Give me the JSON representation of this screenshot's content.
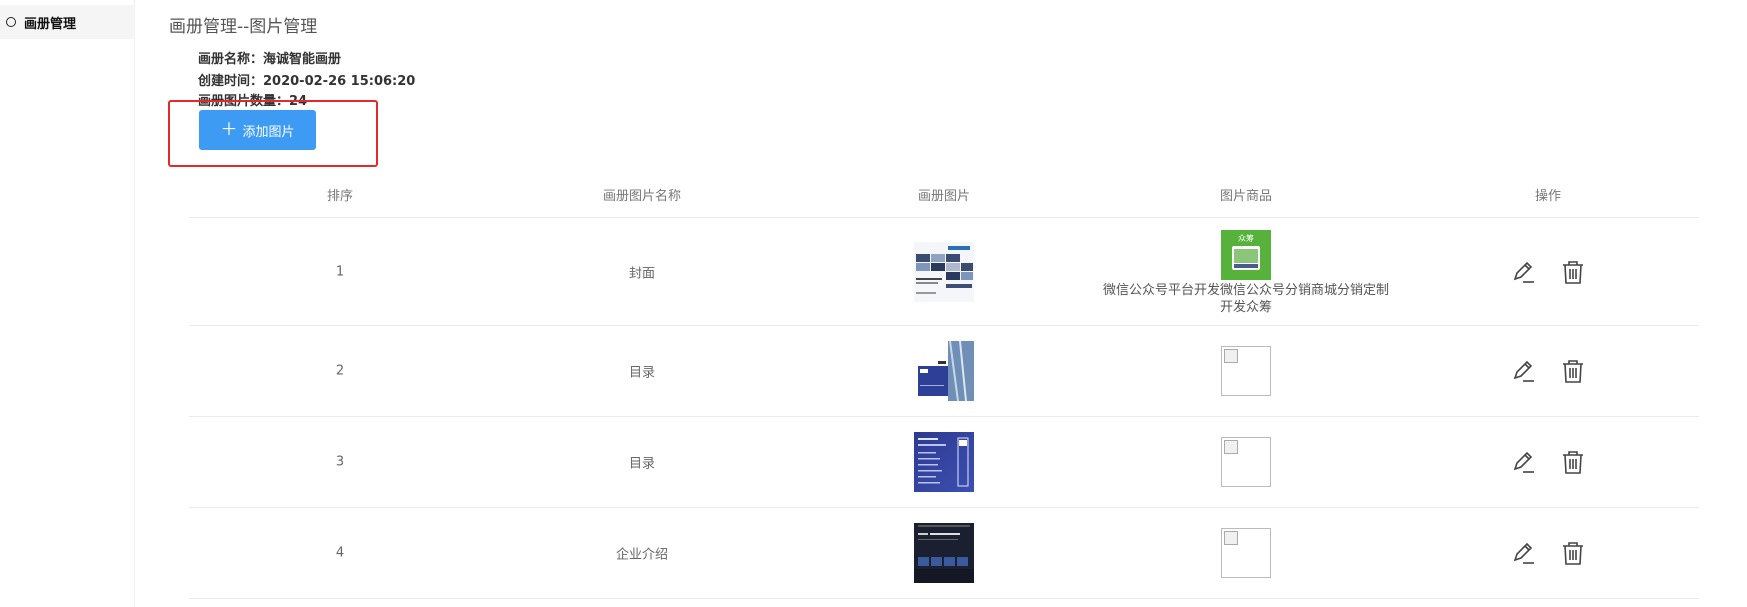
{
  "sidebar": {
    "items": [
      {
        "label": "画册管理"
      }
    ]
  },
  "header": {
    "title": "画册管理--图片管理"
  },
  "album": {
    "name_line": "画册名称：海诚智能画册",
    "created_line": "创建时间：2020-02-26 15:06:20",
    "count_line": "画册图片数量：24"
  },
  "toolbar": {
    "add_label": "添加图片"
  },
  "table": {
    "headers": [
      "排序",
      "画册图片名称",
      "画册图片",
      "图片商品",
      "操作"
    ],
    "rows": [
      {
        "order": "1",
        "name": "封面",
        "thumb": "cover",
        "goods_text": "微信公众号平台开发微信公众号分销商城分销定制开发众筹",
        "goods_badge": "众筹"
      },
      {
        "order": "2",
        "name": "目录",
        "thumb": "blue-building",
        "goods_text": ""
      },
      {
        "order": "3",
        "name": "目录",
        "thumb": "dark-blue",
        "goods_text": ""
      },
      {
        "order": "4",
        "name": "企业介绍",
        "thumb": "dark",
        "goods_text": ""
      }
    ]
  },
  "colors": {
    "accent": "#3d9bf3",
    "highlight": "#e32a2a"
  },
  "icons": {
    "edit": "pencil-icon",
    "delete": "trash-icon"
  }
}
